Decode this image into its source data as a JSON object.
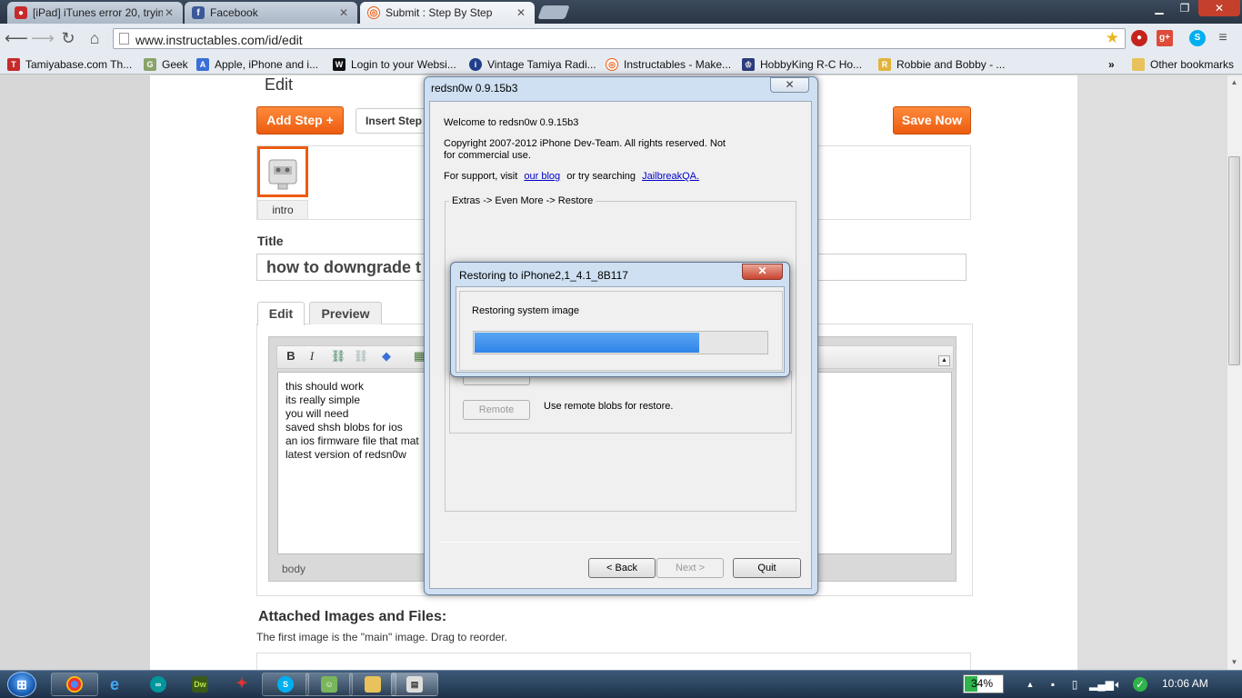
{
  "browser": {
    "tabs": [
      {
        "label": "[iPad] iTunes error 20, tryin",
        "favicon": "apple-icon",
        "active": false
      },
      {
        "label": "Facebook",
        "favicon": "facebook-icon",
        "active": false
      },
      {
        "label": "Submit : Step By Step",
        "favicon": "instructables-icon",
        "active": true
      }
    ],
    "url": "www.instructables.com/id/edit",
    "bookmarks": [
      {
        "label": "Tamiyabase.com Th...",
        "icon": "tamiya-icon"
      },
      {
        "label": "Geek",
        "icon": "geek-icon"
      },
      {
        "label": "Apple, iPhone and i...",
        "icon": "apple-icon"
      },
      {
        "label": "Login to your Websi...",
        "icon": "w-icon"
      },
      {
        "label": "Vintage Tamiya Radi...",
        "icon": "info-icon"
      },
      {
        "label": "Instructables - Make...",
        "icon": "instructables-icon"
      },
      {
        "label": "HobbyKing R-C Ho...",
        "icon": "hobbyking-icon"
      },
      {
        "label": "Robbie and Bobby - ...",
        "icon": "robbie-icon"
      }
    ],
    "bookmarks_overflow": "»",
    "other_bookmarks": "Other bookmarks"
  },
  "page": {
    "edit_label": "Edit",
    "add_step": "Add Step +",
    "insert_step": "Insert Step",
    "save_now": "Save Now",
    "intro_label": "intro",
    "title_label": "Title",
    "title_value": "how to downgrade t",
    "tabs": [
      "Edit",
      "Preview"
    ],
    "editor_lines": [
      "this should work",
      "its really simple",
      "you will need",
      "saved shsh blobs for ios",
      "an ios firmware file that mat",
      "latest version of redsn0w"
    ],
    "editor_path": "body",
    "attached_title": "Attached Images and Files:",
    "attached_hint": "The first image is the \"main\" image. Drag to reorder."
  },
  "redsn0w": {
    "title": "redsn0w 0.9.15b3",
    "welcome": "Welcome to redsn0w 0.9.15b3",
    "copyright_1": "Copyright 2007-2012 iPhone Dev-Team. All rights reserved. Not",
    "copyright_2": "for commercial use.",
    "support_prefix": "For support, visit",
    "blog_link": "our blog",
    "support_mid": "or try searching",
    "jailbreak_link": "JailbreakQA.",
    "group_label": "Extras -> Even More -> Restore",
    "remote_button": "Remote",
    "remote_desc": "Use remote blobs for restore.",
    "back": "< Back",
    "next": "Next >",
    "quit": "Quit"
  },
  "restore_dialog": {
    "title": "Restoring to iPhone2,1_4.1_8B117",
    "status": "Restoring system image",
    "progress": 0.77
  },
  "taskbar": {
    "apps": [
      {
        "name": "chrome",
        "icon": "chrome-icon"
      },
      {
        "name": "ie",
        "icon": "ie-icon"
      },
      {
        "name": "arduino",
        "icon": "arduino-icon"
      },
      {
        "name": "dreamweaver",
        "icon": "dreamweaver-icon"
      },
      {
        "name": "redsn0w",
        "icon": "redsn0w-icon"
      },
      {
        "name": "skype",
        "icon": "skype-icon"
      },
      {
        "name": "messenger",
        "icon": "messenger-icon"
      },
      {
        "name": "explorer",
        "icon": "folder-icon"
      },
      {
        "name": "app-window",
        "icon": "window-icon"
      }
    ],
    "battery": "34%",
    "battery_level": 0.34,
    "clock": "10:06 AM"
  }
}
